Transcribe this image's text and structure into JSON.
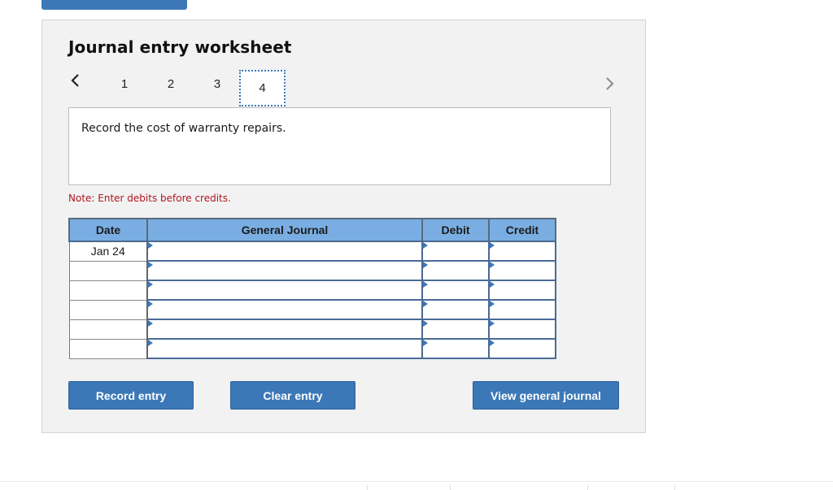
{
  "header": {
    "title": "Journal entry worksheet"
  },
  "pager": {
    "prev_icon": "chevron-left-icon",
    "next_icon": "chevron-right-icon",
    "tabs": [
      {
        "label": "1",
        "active": false
      },
      {
        "label": "2",
        "active": false
      },
      {
        "label": "3",
        "active": false
      },
      {
        "label": "4",
        "active": true
      }
    ]
  },
  "prompt": {
    "text": "Record the cost of warranty repairs."
  },
  "note": {
    "text": "Note: Enter debits before credits.",
    "color": "#b0161f"
  },
  "journal": {
    "columns": [
      "Date",
      "General Journal",
      "Debit",
      "Credit"
    ],
    "rows": [
      {
        "date": "Jan 24",
        "account": "",
        "debit": "",
        "credit": ""
      },
      {
        "date": "",
        "account": "",
        "debit": "",
        "credit": ""
      },
      {
        "date": "",
        "account": "",
        "debit": "",
        "credit": ""
      },
      {
        "date": "",
        "account": "",
        "debit": "",
        "credit": ""
      },
      {
        "date": "",
        "account": "",
        "debit": "",
        "credit": ""
      },
      {
        "date": "",
        "account": "",
        "debit": "",
        "credit": ""
      }
    ]
  },
  "buttons": {
    "record": "Record entry",
    "clear": "Clear entry",
    "view": "View general journal"
  },
  "colors": {
    "accent": "#3c78b8",
    "header_fill": "#7aaee2",
    "panel_bg": "#f2f2f2"
  }
}
